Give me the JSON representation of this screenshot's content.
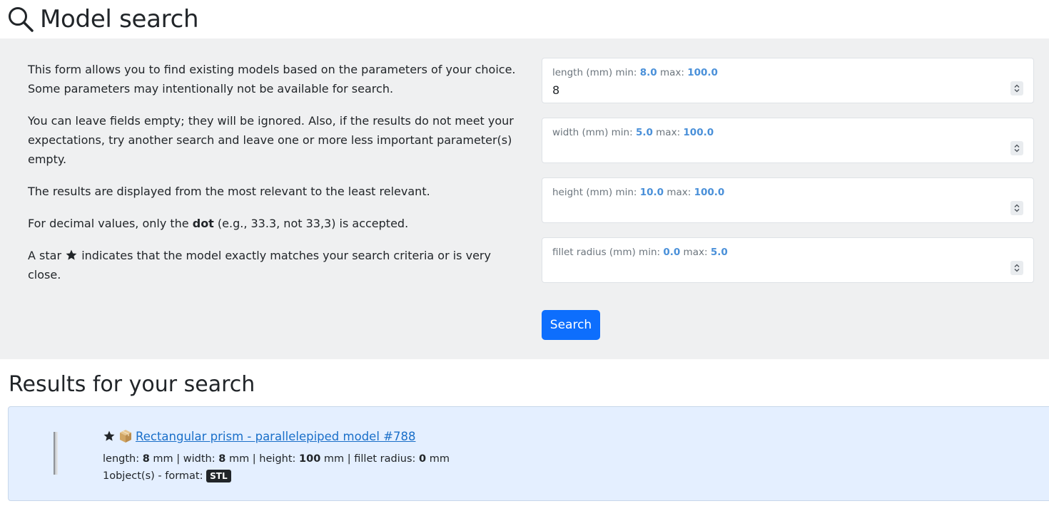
{
  "header": {
    "title": "Model search",
    "icon": "search-icon"
  },
  "info": {
    "p1": "This form allows you to find existing models based on the parameters of your choice. Some parameters may intentionally not be available for search.",
    "p2": "You can leave fields empty; they will be ignored. Also, if the results do not meet your expectations, try another search and leave one or more less important parameter(s) empty.",
    "p3": "The results are displayed from the most relevant to the least relevant.",
    "p4_pre": "For decimal values, only the ",
    "p4_bold": "dot",
    "p4_post": " (e.g., 33.3, not 33,3) is accepted.",
    "p5_pre": "A star ",
    "p5_post": " indicates that the model exactly matches your search criteria or is very close."
  },
  "fields": [
    {
      "label": "length (mm) min: ",
      "max_label": " max: ",
      "min": "8.0",
      "max": "100.0",
      "value": "8"
    },
    {
      "label": "width (mm) min: ",
      "max_label": " max: ",
      "min": "5.0",
      "max": "100.0",
      "value": ""
    },
    {
      "label": "height (mm) min: ",
      "max_label": " max: ",
      "min": "10.0",
      "max": "100.0",
      "value": ""
    },
    {
      "label": "fillet radius (mm) min: ",
      "max_label": " max: ",
      "min": "0.0",
      "max": "5.0",
      "value": ""
    }
  ],
  "search_button": "Search",
  "results": {
    "title": "Results for your search",
    "items": [
      {
        "name": "Rectangular prism - parallelepiped model #788",
        "length_label": "length: ",
        "length": "8",
        "length_unit": " mm | width: ",
        "width": "8",
        "width_unit": " mm | height: ",
        "height": "100",
        "height_unit": " mm | fillet radius: ",
        "fillet": "0",
        "fillet_unit": " mm",
        "objects": "1object(s) - format: ",
        "format": "STL"
      }
    ]
  },
  "colors": {
    "accent": "#0d6efd",
    "panel": "#eff0f1",
    "card": "#e4efff",
    "number": "#4a90d9"
  }
}
